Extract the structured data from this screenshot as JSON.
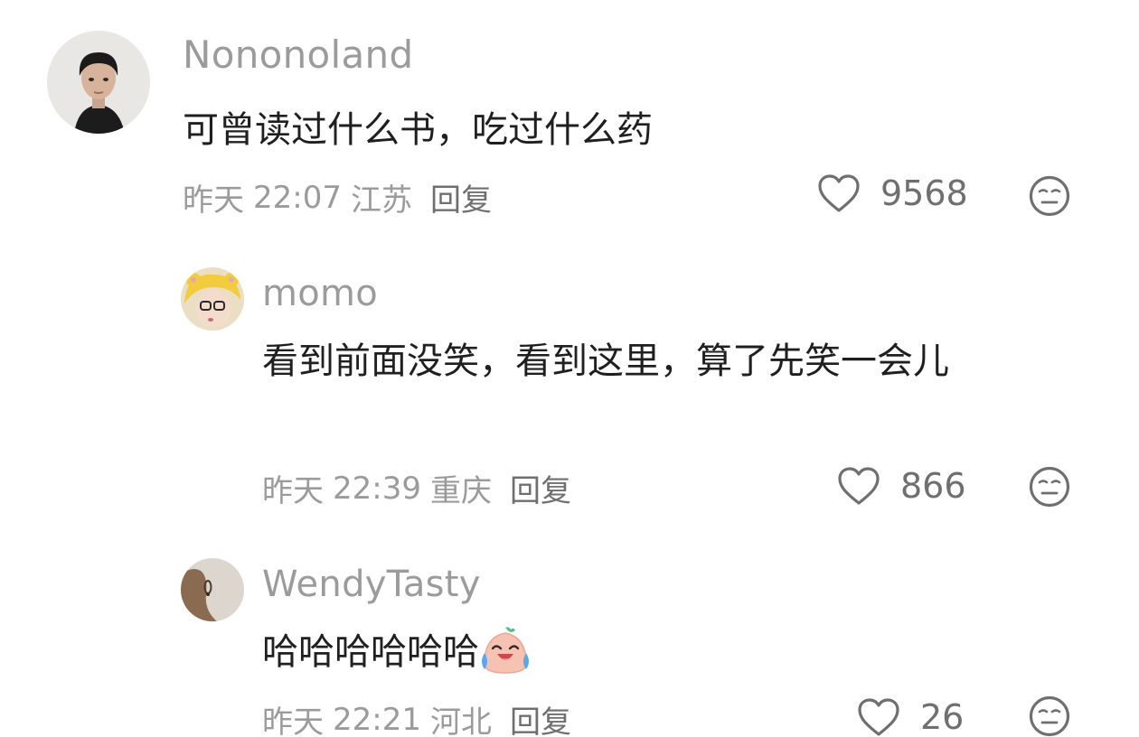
{
  "comments": [
    {
      "username": "Nononoland",
      "text": "可曾读过什么书，吃过什么药",
      "date": "昨天",
      "time": "22:07",
      "location": "江苏",
      "reply_label": "回复",
      "likes": "9568",
      "avatar_icon": "person-photo-avatar"
    },
    {
      "username": "momo",
      "text": "看到前面没笑，看到这里，算了先笑一会儿",
      "date": "昨天",
      "time": "22:39",
      "location": "重庆",
      "reply_label": "回复",
      "likes": "866",
      "avatar_icon": "yellow-hat-avatar"
    },
    {
      "username": "WendyTasty",
      "text": "哈哈哈哈哈哈",
      "text_emoji": "laugh-cry-emoji",
      "date": "昨天",
      "time": "22:21",
      "location": "河北",
      "reply_label": "回复",
      "likes": "26",
      "avatar_icon": "profile-photo-avatar"
    }
  ],
  "colors": {
    "username": "#9b9b9b",
    "text": "#1f1f1f",
    "meta": "#9b9b9b",
    "icon": "#6f6f6f"
  }
}
